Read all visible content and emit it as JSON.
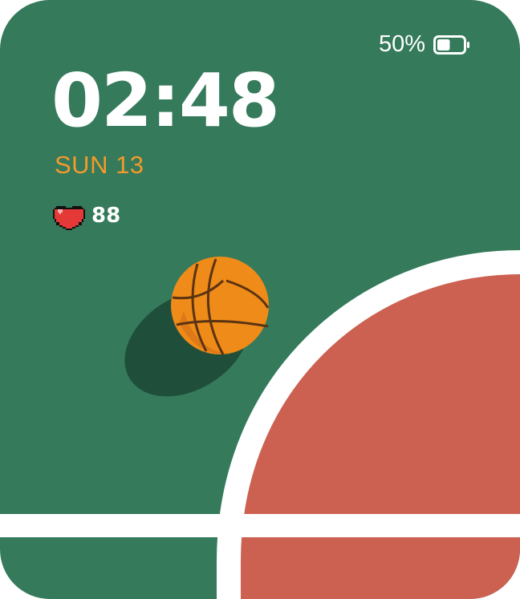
{
  "status": {
    "battery_percent_label": "50%",
    "battery_level": 0.5
  },
  "clock": {
    "time": "02:48",
    "date": "SUN 13"
  },
  "health": {
    "heart_rate": "88",
    "heart_icon": "pixel-heart-icon"
  },
  "colors": {
    "court_green": "#347a5b",
    "court_red": "#cc6151",
    "line_white": "#ffffff",
    "accent_orange": "#f39a2b",
    "ball_orange": "#ef8b18"
  }
}
